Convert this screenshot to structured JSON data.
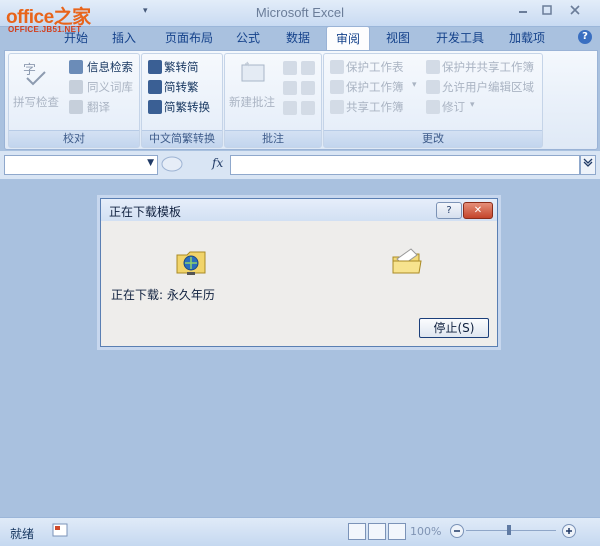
{
  "logo": {
    "main": "office之家",
    "url": "OFFICE.JB51.NET"
  },
  "app_title": "Microsoft Excel",
  "qat": {
    "dropdown": "▾"
  },
  "tabs": [
    {
      "label": "开始"
    },
    {
      "label": "插入"
    },
    {
      "label": "页面布局"
    },
    {
      "label": "公式"
    },
    {
      "label": "数据"
    },
    {
      "label": "审阅"
    },
    {
      "label": "视图"
    },
    {
      "label": "开发工具"
    },
    {
      "label": "加载项"
    }
  ],
  "active_tab": "审阅",
  "groups": {
    "proofing": {
      "label": "校对",
      "spell": "拼写检查",
      "research": "信息检索",
      "thesaurus": "同义词库",
      "translate": "翻译"
    },
    "chinese": {
      "label": "中文简繁转换",
      "to_simplified": "繁转简",
      "to_traditional": "简转繁",
      "convert": "简繁转换"
    },
    "comments": {
      "label": "批注",
      "new_comment": "新建批注"
    },
    "changes": {
      "label": "更改",
      "protect_sheet": "保护工作表",
      "protect_workbook": "保护工作簿",
      "share_workbook": "共享工作簿",
      "protect_share": "保护并共享工作簿",
      "allow_edit": "允许用户编辑区域",
      "track": "修订"
    }
  },
  "formula_bar": {
    "fx": "fx",
    "name_value": "",
    "formula_value": ""
  },
  "dialog": {
    "title": "正在下载模板",
    "help": "?",
    "close": "✕",
    "status": "正在下载: 永久年历",
    "stop_button": "停止(S)"
  },
  "status_bar": {
    "ready": "就绪",
    "zoom": "100%"
  },
  "colors": {
    "accent": "#15428b",
    "logo": "#e8641b",
    "background": "#a9c1df"
  }
}
